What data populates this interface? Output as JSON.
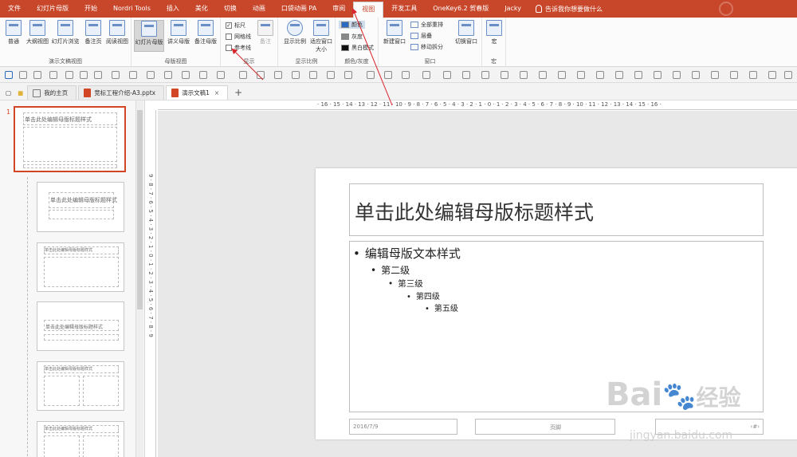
{
  "tabs": [
    "文件",
    "幻灯片母版",
    "开始",
    "Nordri Tools",
    "插入",
    "美化",
    "切换",
    "动画",
    "口袋动画 PA",
    "审阅",
    "视图",
    "开发工具",
    "OneKey6.2 贺春版",
    "Jacky"
  ],
  "active_tab": "视图",
  "search_hint": "告诉我你想要做什么",
  "ribbon": {
    "views": {
      "normal": "普通",
      "outline": "大纲视图",
      "sorter": "幻灯片浏览",
      "notes_page": "备注页",
      "reading": "阅读视图",
      "label": "演示文稿视图"
    },
    "master": {
      "slide_master": "幻灯片母版",
      "handout_master": "讲义母版",
      "notes_master": "备注母版",
      "label": "母版视图"
    },
    "show": {
      "ruler": "标尺",
      "gridlines": "网格线",
      "guides": "参考线",
      "notes": "备注",
      "label": "显示"
    },
    "zoom": {
      "zoom": "显示比例",
      "fit": "适应窗口大小",
      "label": "显示比例"
    },
    "color": {
      "color": "颜色",
      "gray": "灰度",
      "bw": "黑白模式",
      "label": "颜色/灰度"
    },
    "window": {
      "new_window": "新建窗口",
      "arrange": "全部重排",
      "cascade": "层叠",
      "split": "移动拆分",
      "switch": "切换窗口",
      "label": "窗口"
    },
    "macro": {
      "macro": "宏",
      "label": "宏"
    }
  },
  "doc_tabs": [
    {
      "label": "我的主页",
      "icon": "home-icon"
    },
    {
      "label": "竞标工程介绍-A3.pptx",
      "icon": "ppt-icon"
    },
    {
      "label": "演示文稿1",
      "icon": "ppt-icon"
    }
  ],
  "thumb_pane": {
    "first_number": "1",
    "master_title": "单击此处编辑母版标题样式",
    "layout_title": "单击此处编辑母版标题样式"
  },
  "ruler": "· 16 · 15 · 14 · 13 · 12 · 11 · 10 · 9 · 8 · 7 · 6 · 5 · 4 · 3 · 2 · 1 · 0 · 1 · 2 · 3 · 4 · 5 · 6 · 7 · 8 · 9 · 10 · 11 · 12 · 13 · 14 · 15 · 16 ·",
  "vruler": "9 · 8 · 7 · 6 · 5 · 4 · 3 · 2 · 1 · 0 · 1 · 2 · 3 · 4 · 5 · 6 · 7 · 8 · 9",
  "slide": {
    "title": "单击此处编辑母版标题样式",
    "levels": [
      "编辑母版文本样式",
      "第二级",
      "第三级",
      "第四级",
      "第五级"
    ],
    "date": "2016/7/9",
    "footer": "页脚",
    "page_no": "‹#›"
  },
  "watermark": {
    "brand": "Bai",
    "brand2": "经验",
    "url": "jingyan.baidu.com"
  },
  "colors": {
    "accent": "#c8462a",
    "ppt": "#d24625"
  }
}
